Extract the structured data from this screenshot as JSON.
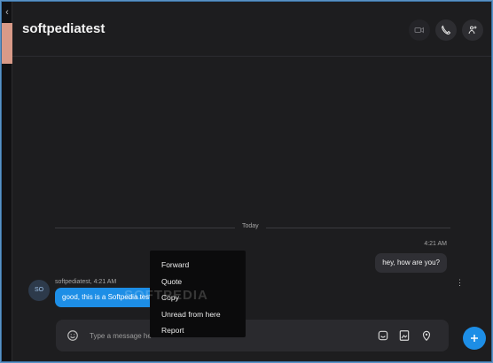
{
  "nav": {
    "back_glyph": "‹"
  },
  "header": {
    "title": "softpediatest",
    "buttons": [
      {
        "name": "video-call",
        "icon": "video-icon"
      },
      {
        "name": "voice-call",
        "icon": "phone-icon"
      },
      {
        "name": "add-participant",
        "icon": "add-person-icon"
      }
    ]
  },
  "conversation": {
    "day_separator": "Today",
    "outgoing": {
      "time": "4:21 AM",
      "text": "hey, how are you?"
    },
    "incoming": {
      "avatar_initials": "SO",
      "meta": "softpediatest, 4:21 AM",
      "text": "good, this is a Softpedia test"
    },
    "more_glyph": "⋮"
  },
  "context_menu": {
    "items": [
      "Forward",
      "Quote",
      "Copy",
      "Unread from here",
      "Report"
    ]
  },
  "composer": {
    "placeholder": "Type a message here"
  },
  "watermark": "SOFTPEDIA",
  "colors": {
    "accent": "#1d8ee6",
    "background": "#1d1d1f",
    "menu": "#0b0b0c"
  }
}
